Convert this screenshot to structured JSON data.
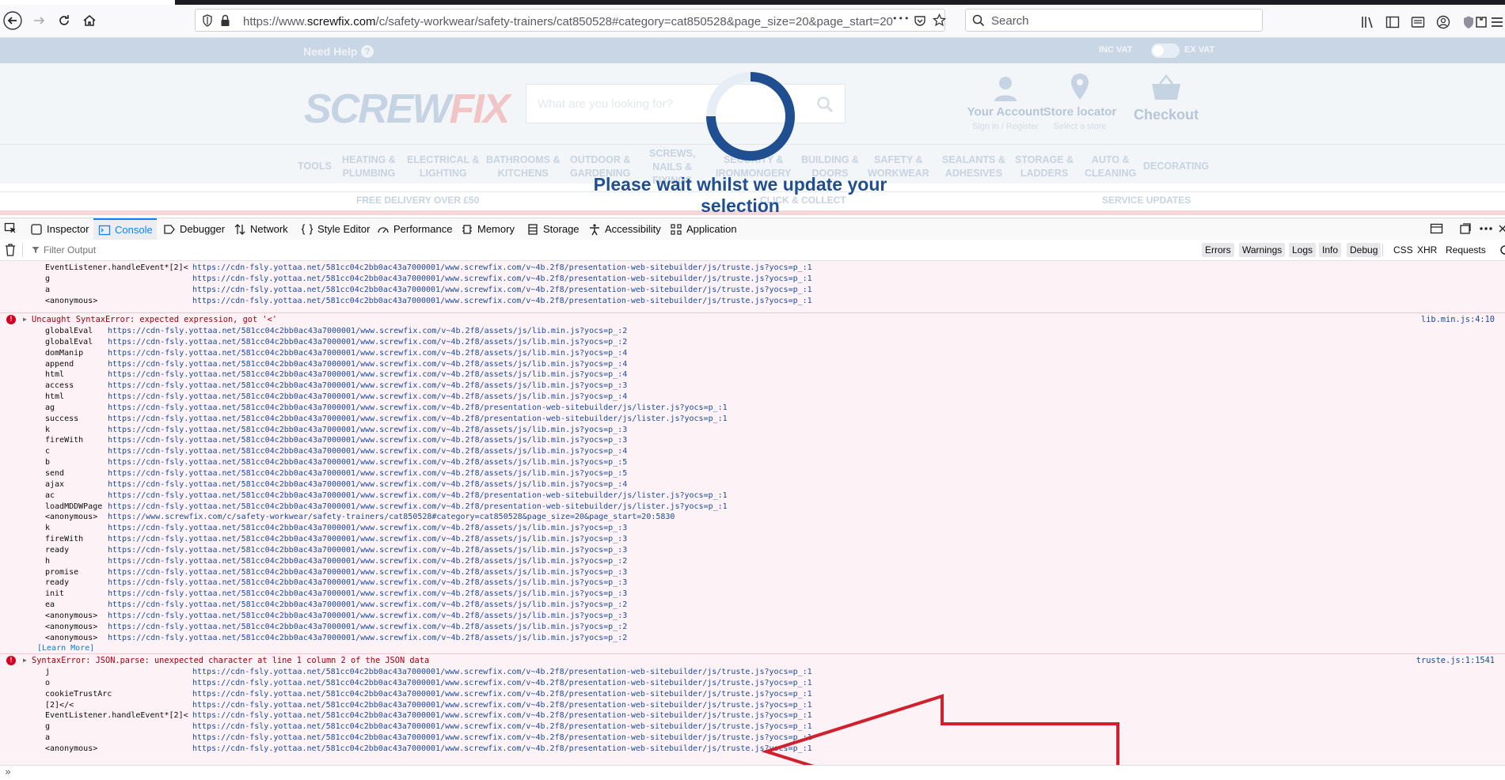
{
  "browser": {
    "url_prefix": "https://www.",
    "url_host": "screwfix.com",
    "url_rest": "/c/safety-workwear/safety-trainers/cat850528#category=cat850528&page_size=20&page_start=20",
    "more_label": "•••",
    "search_placeholder": "Search"
  },
  "site": {
    "need_help": "Need Help",
    "inc_vat": "INC VAT",
    "ex_vat": "EX VAT",
    "logo_screw": "SCREW",
    "logo_fix": "FIX",
    "search_placeholder": "What are you looking for?",
    "account_title": "Your Account",
    "account_sub": "Sign in / Register",
    "store_title": "Store locator",
    "store_sub": "Select a store",
    "checkout": "Checkout",
    "categories": [
      [
        "TOOLS"
      ],
      [
        "HEATING &",
        "PLUMBING"
      ],
      [
        "ELECTRICAL &",
        "LIGHTING"
      ],
      [
        "BATHROOMS &",
        "KITCHENS"
      ],
      [
        "OUTDOOR &",
        "GARDENING"
      ],
      [
        "SCREWS,",
        "NAILS &",
        "FIXINGS"
      ],
      [
        "SECURITY &",
        "IRONMONGERY"
      ],
      [
        "BUILDING &",
        "DOORS"
      ],
      [
        "SAFETY &",
        "WORKWEAR"
      ],
      [
        "SEALANTS &",
        "ADHESIVES"
      ],
      [
        "STORAGE &",
        "LADDERS"
      ],
      [
        "AUTO &",
        "CLEANING"
      ],
      [
        "DECORATING"
      ]
    ],
    "services": [
      "FREE DELIVERY OVER £50",
      "CLICK & COLLECT",
      "SERVICE UPDATES"
    ],
    "overlay_message": "Please wait whilst we update your selection"
  },
  "devtools": {
    "tabs": [
      "Inspector",
      "Console",
      "Debugger",
      "Network",
      "Style Editor",
      "Performance",
      "Memory",
      "Storage",
      "Accessibility",
      "Application"
    ],
    "active_tab": "Console",
    "filter_placeholder": "Filter Output",
    "filters": [
      "Errors",
      "Warnings",
      "Logs",
      "Info",
      "Debug"
    ],
    "request_filters": [
      "CSS",
      "XHR",
      "Requests"
    ],
    "console_prompt": "»"
  },
  "console": {
    "top_frames": [
      {
        "fn": "EventListener.handleEvent*[2]<",
        "src": "https://cdn-fsly.yottaa.net/581cc04c2bb0ac43a7000001/www.screwfix.com/v~4b.2f8/presentation-web-sitebuilder/js/truste.js?yocs=p_:1"
      },
      {
        "fn": "g",
        "src": "https://cdn-fsly.yottaa.net/581cc04c2bb0ac43a7000001/www.screwfix.com/v~4b.2f8/presentation-web-sitebuilder/js/truste.js?yocs=p_:1"
      },
      {
        "fn": "a",
        "src": "https://cdn-fsly.yottaa.net/581cc04c2bb0ac43a7000001/www.screwfix.com/v~4b.2f8/presentation-web-sitebuilder/js/truste.js?yocs=p_:1"
      },
      {
        "fn": "<anonymous>",
        "src": "https://cdn-fsly.yottaa.net/581cc04c2bb0ac43a7000001/www.screwfix.com/v~4b.2f8/presentation-web-sitebuilder/js/truste.js?yocs=p_:1"
      }
    ],
    "error1": {
      "text": "Uncaught SyntaxError: expected expression, got '<'",
      "location": "lib.min.js:4:10",
      "frames": [
        {
          "fn": "globalEval",
          "src": "https://cdn-fsly.yottaa.net/581cc04c2bb0ac43a7000001/www.screwfix.com/v~4b.2f8/assets/js/lib.min.js?yocs=p_:2"
        },
        {
          "fn": "globalEval",
          "src": "https://cdn-fsly.yottaa.net/581cc04c2bb0ac43a7000001/www.screwfix.com/v~4b.2f8/assets/js/lib.min.js?yocs=p_:2"
        },
        {
          "fn": "domManip",
          "src": "https://cdn-fsly.yottaa.net/581cc04c2bb0ac43a7000001/www.screwfix.com/v~4b.2f8/assets/js/lib.min.js?yocs=p_:4"
        },
        {
          "fn": "append",
          "src": "https://cdn-fsly.yottaa.net/581cc04c2bb0ac43a7000001/www.screwfix.com/v~4b.2f8/assets/js/lib.min.js?yocs=p_:4"
        },
        {
          "fn": "html",
          "src": "https://cdn-fsly.yottaa.net/581cc04c2bb0ac43a7000001/www.screwfix.com/v~4b.2f8/assets/js/lib.min.js?yocs=p_:4"
        },
        {
          "fn": "access",
          "src": "https://cdn-fsly.yottaa.net/581cc04c2bb0ac43a7000001/www.screwfix.com/v~4b.2f8/assets/js/lib.min.js?yocs=p_:3"
        },
        {
          "fn": "html",
          "src": "https://cdn-fsly.yottaa.net/581cc04c2bb0ac43a7000001/www.screwfix.com/v~4b.2f8/assets/js/lib.min.js?yocs=p_:4"
        },
        {
          "fn": "ag",
          "src": "https://cdn-fsly.yottaa.net/581cc04c2bb0ac43a7000001/www.screwfix.com/v~4b.2f8/presentation-web-sitebuilder/js/lister.js?yocs=p_:1"
        },
        {
          "fn": "success",
          "src": "https://cdn-fsly.yottaa.net/581cc04c2bb0ac43a7000001/www.screwfix.com/v~4b.2f8/presentation-web-sitebuilder/js/lister.js?yocs=p_:1"
        },
        {
          "fn": "k",
          "src": "https://cdn-fsly.yottaa.net/581cc04c2bb0ac43a7000001/www.screwfix.com/v~4b.2f8/assets/js/lib.min.js?yocs=p_:3"
        },
        {
          "fn": "fireWith",
          "src": "https://cdn-fsly.yottaa.net/581cc04c2bb0ac43a7000001/www.screwfix.com/v~4b.2f8/assets/js/lib.min.js?yocs=p_:3"
        },
        {
          "fn": "c",
          "src": "https://cdn-fsly.yottaa.net/581cc04c2bb0ac43a7000001/www.screwfix.com/v~4b.2f8/assets/js/lib.min.js?yocs=p_:4"
        },
        {
          "fn": "b",
          "src": "https://cdn-fsly.yottaa.net/581cc04c2bb0ac43a7000001/www.screwfix.com/v~4b.2f8/assets/js/lib.min.js?yocs=p_:5"
        },
        {
          "fn": "send",
          "src": "https://cdn-fsly.yottaa.net/581cc04c2bb0ac43a7000001/www.screwfix.com/v~4b.2f8/assets/js/lib.min.js?yocs=p_:5"
        },
        {
          "fn": "ajax",
          "src": "https://cdn-fsly.yottaa.net/581cc04c2bb0ac43a7000001/www.screwfix.com/v~4b.2f8/assets/js/lib.min.js?yocs=p_:4"
        },
        {
          "fn": "ac",
          "src": "https://cdn-fsly.yottaa.net/581cc04c2bb0ac43a7000001/www.screwfix.com/v~4b.2f8/presentation-web-sitebuilder/js/lister.js?yocs=p_:1"
        },
        {
          "fn": "loadMDDWPage",
          "src": "https://cdn-fsly.yottaa.net/581cc04c2bb0ac43a7000001/www.screwfix.com/v~4b.2f8/presentation-web-sitebuilder/js/lister.js?yocs=p_:1"
        },
        {
          "fn": "<anonymous>",
          "src": "https://www.screwfix.com/c/safety-workwear/safety-trainers/cat850528#category=cat850528&page_size=20&page_start=20:5830"
        },
        {
          "fn": "k",
          "src": "https://cdn-fsly.yottaa.net/581cc04c2bb0ac43a7000001/www.screwfix.com/v~4b.2f8/assets/js/lib.min.js?yocs=p_:3"
        },
        {
          "fn": "fireWith",
          "src": "https://cdn-fsly.yottaa.net/581cc04c2bb0ac43a7000001/www.screwfix.com/v~4b.2f8/assets/js/lib.min.js?yocs=p_:3"
        },
        {
          "fn": "ready",
          "src": "https://cdn-fsly.yottaa.net/581cc04c2bb0ac43a7000001/www.screwfix.com/v~4b.2f8/assets/js/lib.min.js?yocs=p_:3"
        },
        {
          "fn": "h",
          "src": "https://cdn-fsly.yottaa.net/581cc04c2bb0ac43a7000001/www.screwfix.com/v~4b.2f8/assets/js/lib.min.js?yocs=p_:2"
        },
        {
          "fn": "promise",
          "src": "https://cdn-fsly.yottaa.net/581cc04c2bb0ac43a7000001/www.screwfix.com/v~4b.2f8/assets/js/lib.min.js?yocs=p_:3"
        },
        {
          "fn": "ready",
          "src": "https://cdn-fsly.yottaa.net/581cc04c2bb0ac43a7000001/www.screwfix.com/v~4b.2f8/assets/js/lib.min.js?yocs=p_:3"
        },
        {
          "fn": "init",
          "src": "https://cdn-fsly.yottaa.net/581cc04c2bb0ac43a7000001/www.screwfix.com/v~4b.2f8/assets/js/lib.min.js?yocs=p_:3"
        },
        {
          "fn": "ea",
          "src": "https://cdn-fsly.yottaa.net/581cc04c2bb0ac43a7000001/www.screwfix.com/v~4b.2f8/assets/js/lib.min.js?yocs=p_:2"
        },
        {
          "fn": "<anonymous>",
          "src": "https://cdn-fsly.yottaa.net/581cc04c2bb0ac43a7000001/www.screwfix.com/v~4b.2f8/assets/js/lib.min.js?yocs=p_:3"
        },
        {
          "fn": "<anonymous>",
          "src": "https://cdn-fsly.yottaa.net/581cc04c2bb0ac43a7000001/www.screwfix.com/v~4b.2f8/assets/js/lib.min.js?yocs=p_:2"
        },
        {
          "fn": "<anonymous>",
          "src": "https://cdn-fsly.yottaa.net/581cc04c2bb0ac43a7000001/www.screwfix.com/v~4b.2f8/assets/js/lib.min.js?yocs=p_:2"
        }
      ],
      "learn_more": "[Learn More]"
    },
    "error2": {
      "text": "SyntaxError: JSON.parse: unexpected character at line 1 column 2 of the JSON data",
      "location": "truste.js:1:1541",
      "frames": [
        {
          "fn": "j",
          "src": "https://cdn-fsly.yottaa.net/581cc04c2bb0ac43a7000001/www.screwfix.com/v~4b.2f8/presentation-web-sitebuilder/js/truste.js?yocs=p_:1"
        },
        {
          "fn": "o",
          "src": "https://cdn-fsly.yottaa.net/581cc04c2bb0ac43a7000001/www.screwfix.com/v~4b.2f8/presentation-web-sitebuilder/js/truste.js?yocs=p_:1"
        },
        {
          "fn": "cookieTrustArc",
          "src": "https://cdn-fsly.yottaa.net/581cc04c2bb0ac43a7000001/www.screwfix.com/v~4b.2f8/presentation-web-sitebuilder/js/truste.js?yocs=p_:1"
        },
        {
          "fn": "[2]</<",
          "src": "https://cdn-fsly.yottaa.net/581cc04c2bb0ac43a7000001/www.screwfix.com/v~4b.2f8/presentation-web-sitebuilder/js/truste.js?yocs=p_:1"
        },
        {
          "fn": "EventListener.handleEvent*[2]<",
          "src": "https://cdn-fsly.yottaa.net/581cc04c2bb0ac43a7000001/www.screwfix.com/v~4b.2f8/presentation-web-sitebuilder/js/truste.js?yocs=p_:1"
        },
        {
          "fn": "g",
          "src": "https://cdn-fsly.yottaa.net/581cc04c2bb0ac43a7000001/www.screwfix.com/v~4b.2f8/presentation-web-sitebuilder/js/truste.js?yocs=p_:1"
        },
        {
          "fn": "a",
          "src": "https://cdn-fsly.yottaa.net/581cc04c2bb0ac43a7000001/www.screwfix.com/v~4b.2f8/presentation-web-sitebuilder/js/truste.js?yocs=p_:1"
        },
        {
          "fn": "<anonymous>",
          "src": "https://cdn-fsly.yottaa.net/581cc04c2bb0ac43a7000001/www.screwfix.com/v~4b.2f8/presentation-web-sitebuilder/js/truste.js?yocs=p_:1"
        }
      ]
    }
  },
  "colors": {
    "error_bg": "#fdf2f5",
    "error_text": "#a4000f",
    "link": "#1a4c9c",
    "annotation_arrow": "#d0202e",
    "spinner": "#1f4f90"
  }
}
